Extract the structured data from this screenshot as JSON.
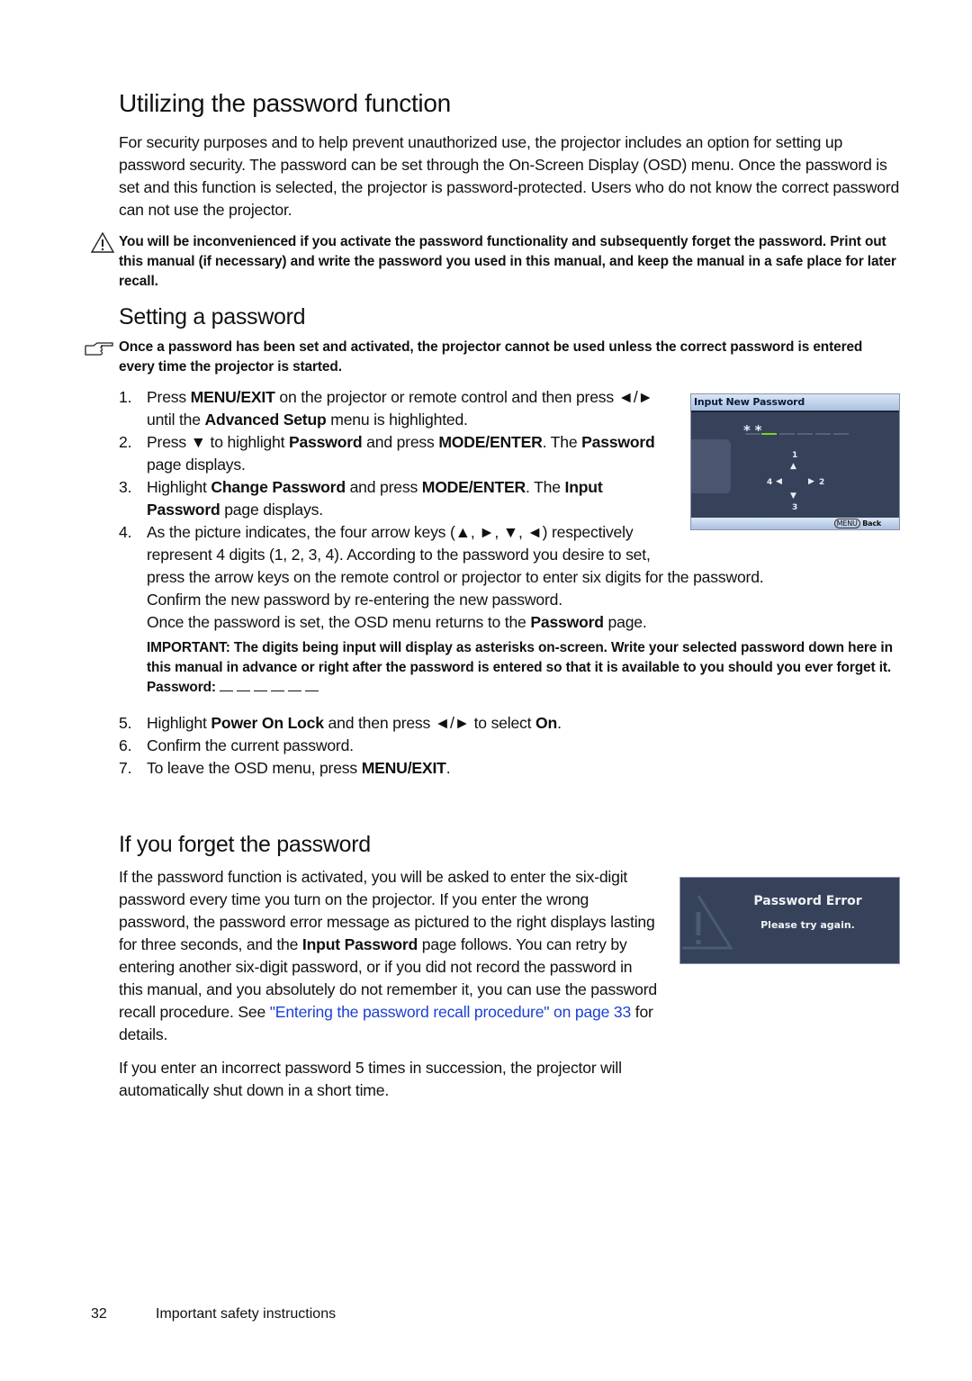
{
  "title": "Utilizing the password function",
  "intro": [
    {
      "t": "For security purposes and to help prevent unauthorized use, the projector includes an option for setting up password security. The password can be set through the On-Screen Display (OSD) menu. Once the password is set and this function is selected, the projector is password-protected. Users who do not know the correct password can not use the projector."
    }
  ],
  "warning": {
    "icon": "warning-triangle-icon",
    "text": "You will be inconvenienced if you activate the password functionality and subsequently forget the password. Print out this manual (if necessary) and write the password you used in this manual, and keep the manual in a safe place for later recall."
  },
  "section1": {
    "heading": "Setting a password",
    "note": {
      "icon": "pointing-hand-icon",
      "text": "Once a password has been set and activated, the projector cannot be used unless the correct password is entered every time the projector is started."
    },
    "steps": [
      {
        "num": "1.",
        "segs": [
          {
            "t": "Press "
          },
          {
            "t": "MENU/EXIT",
            "b": true
          },
          {
            "t": " on the projector or remote control and then press ◄/► until the "
          },
          {
            "t": "Advanced Setup",
            "b": true
          },
          {
            "t": " menu is highlighted."
          }
        ]
      },
      {
        "num": "2.",
        "segs": [
          {
            "t": "Press ▼ to highlight "
          },
          {
            "t": "Password",
            "b": true
          },
          {
            "t": " and press "
          },
          {
            "t": "MODE/ENTER",
            "b": true
          },
          {
            "t": ". The "
          },
          {
            "t": "Password",
            "b": true
          },
          {
            "t": " page displays."
          }
        ]
      },
      {
        "num": "3.",
        "segs": [
          {
            "t": "Highlight "
          },
          {
            "t": "Change Password",
            "b": true
          },
          {
            "t": " and press "
          },
          {
            "t": "MODE/ENTER",
            "b": true
          },
          {
            "t": ". The "
          },
          {
            "t": "Input Password",
            "b": true
          },
          {
            "t": " page displays."
          }
        ]
      },
      {
        "num": "4.",
        "segs": [
          {
            "t": "As the picture indicates, the four arrow keys (▲, ►, ▼, ◄) respectively represent 4 digits (1, 2, 3, 4). According to the password you desire to set, press the arrow keys on the remote control or projector to enter six digits for the password."
          }
        ],
        "extra": [
          [
            {
              "t": "Confirm the new password by re-entering the new password."
            }
          ],
          [
            {
              "t": "Once the password is set, the OSD menu returns to the "
            },
            {
              "t": "Password",
              "b": true
            },
            {
              "t": " page."
            }
          ]
        ],
        "important": "IMPORTANT: The digits being input will display as asterisks on-screen. Write your selected password down here in this manual in advance or right after the password is entered so that it is available to you should you ever forget it.",
        "password_label": "Password:"
      },
      {
        "num": "5.",
        "segs": [
          {
            "t": "Highlight "
          },
          {
            "t": "Power On Lock",
            "b": true
          },
          {
            "t": " and then press ◄/► to select "
          },
          {
            "t": "On",
            "b": true
          },
          {
            "t": "."
          }
        ]
      },
      {
        "num": "6.",
        "segs": [
          {
            "t": "Confirm the current password."
          }
        ]
      },
      {
        "num": "7.",
        "segs": [
          {
            "t": "To leave the OSD menu, press "
          },
          {
            "t": "MENU/EXIT",
            "b": true
          },
          {
            "t": "."
          }
        ]
      }
    ],
    "osd": {
      "title": "Input New Password",
      "entered": "* *",
      "digits": [
        "1",
        "2",
        "3",
        "4"
      ],
      "menu_key": "MENU",
      "back": "Back",
      "accent": "#7ed321"
    }
  },
  "section2": {
    "heading": "If you forget the password",
    "p1": [
      {
        "t": "If the password function is activated, you will be asked to enter the six-digit password every time you turn on the projector. If you enter the wrong password, the password error message as pictured to the right displays lasting for three seconds, and the "
      },
      {
        "t": "Input Password",
        "b": true
      },
      {
        "t": " page follows. You can retry by entering another six-digit password, or if you did not record the password in this manual, and you absolutely do not remember it, you can use the password recall procedure. See "
      },
      {
        "t": "\"Entering the password recall procedure\" on page 33",
        "link": true
      },
      {
        "t": " for details."
      }
    ],
    "p2": [
      {
        "t": "If you enter an incorrect password 5 times in succession, the projector will automatically shut down in a short time."
      }
    ],
    "error_osd": {
      "title": "Password Error",
      "message": "Please try again."
    }
  },
  "footer": {
    "page": "32",
    "section": "Important safety instructions"
  }
}
